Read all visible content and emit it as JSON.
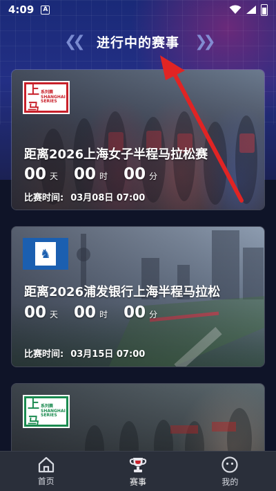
{
  "statusbar": {
    "time": "4:09",
    "badge": "A"
  },
  "header": {
    "title": "进行中的赛事"
  },
  "races": [
    {
      "logo_mark": "上马",
      "logo_series": "系列赛",
      "logo_series_en": "SHANGHAI SERIES",
      "name": "距离2026上海女子半程马拉松赛",
      "days": "00",
      "hours": "00",
      "minutes": "00",
      "start_label": "比赛时间:",
      "start_time": "03月08日 07:00"
    },
    {
      "name": "距离2026浦发银行上海半程马拉松",
      "days": "00",
      "hours": "00",
      "minutes": "00",
      "start_label": "比赛时间:",
      "start_time": "03月15日 07:00"
    },
    {
      "logo_mark": "上马",
      "logo_series": "系列赛",
      "logo_series_en": "SHANGHAI SERIES"
    }
  ],
  "countdown_units": {
    "days": "天",
    "hours": "时",
    "minutes": "分"
  },
  "bottom_nav": [
    {
      "label": "首页",
      "icon": "home-icon",
      "active": false
    },
    {
      "label": "赛事",
      "icon": "trophy-icon",
      "active": true
    },
    {
      "label": "我的",
      "icon": "profile-icon",
      "active": false
    }
  ],
  "colors": {
    "accent_red": "#e02424",
    "nav_bg": "#2a2f3a",
    "header_blue": "#232f85"
  }
}
